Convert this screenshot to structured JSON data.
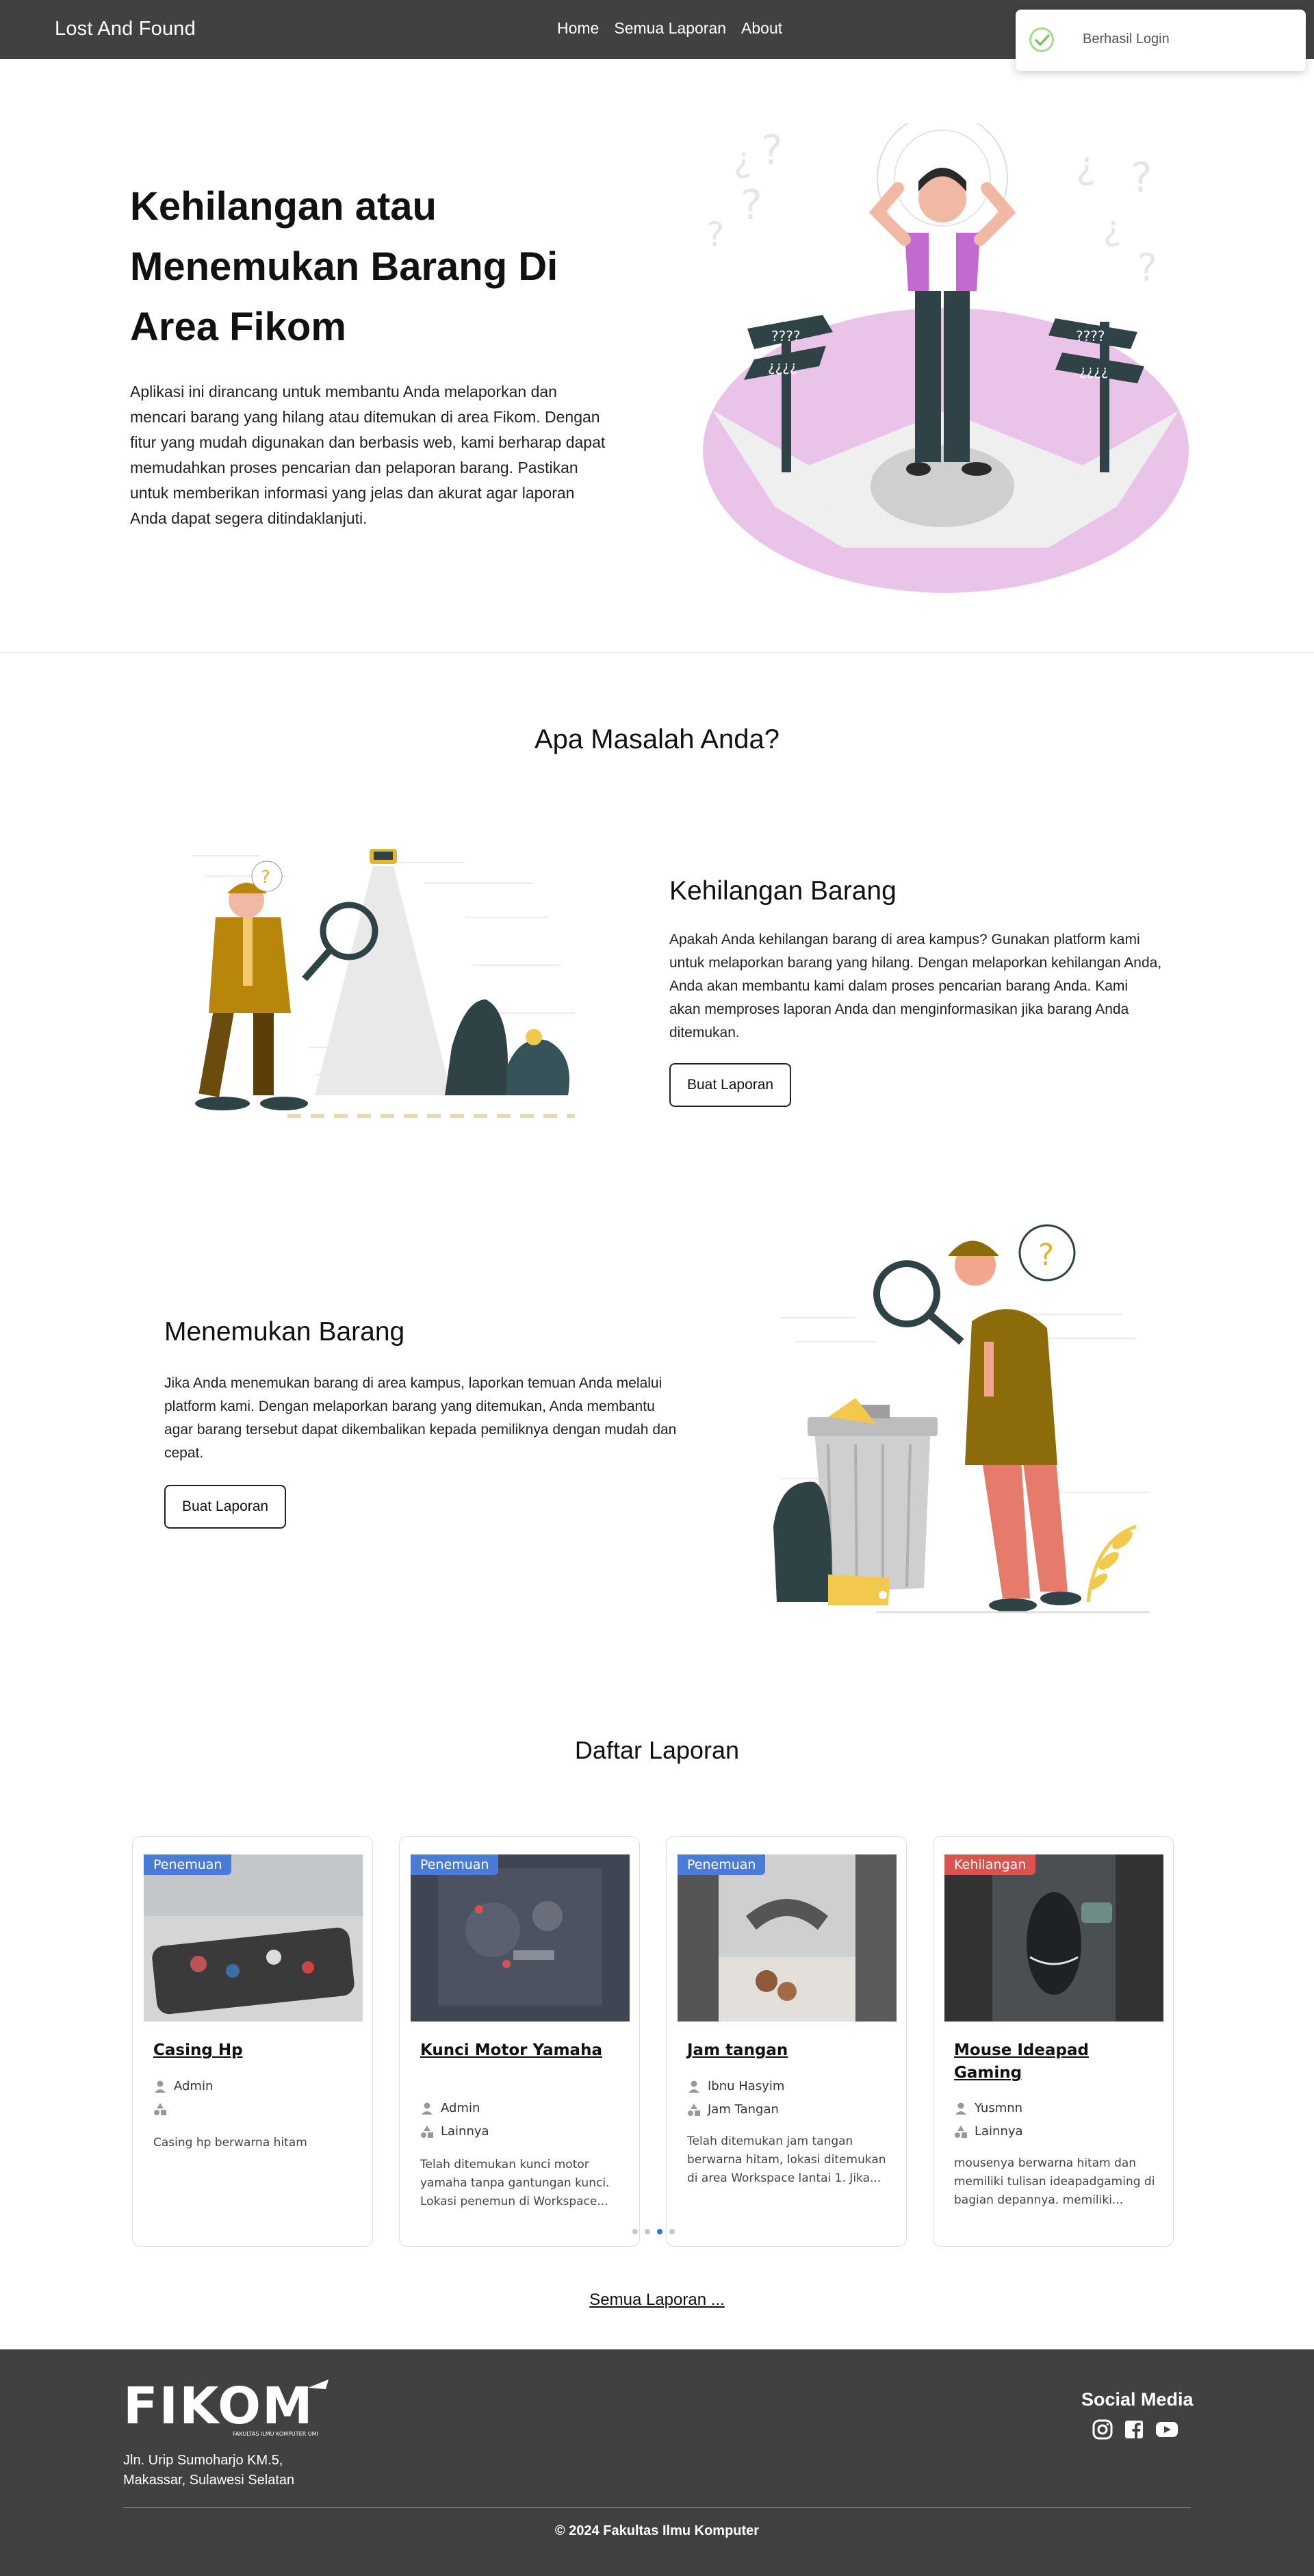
{
  "nav": {
    "brand": "Lost And Found",
    "links": [
      "Home",
      "Semua Laporan",
      "About"
    ]
  },
  "toast": {
    "message": "Berhasil Login",
    "icon": "check-circle-icon"
  },
  "hero": {
    "title": "Kehilangan atau Menemukan Barang Di Area Fikom",
    "description": "Aplikasi ini dirancang untuk membantu Anda melaporkan dan mencari barang yang hilang atau ditemukan di area Fikom. Dengan fitur yang mudah digunakan dan berbasis web, kami berharap dapat memudahkan proses pencarian dan pelaporan barang. Pastikan untuk memberikan informasi yang jelas dan akurat agar laporan Anda dapat segera ditindaklanjuti."
  },
  "problem": {
    "title": "Apa Masalah Anda?",
    "lost": {
      "title": "Kehilangan Barang",
      "description": "Apakah Anda kehilangan barang di area kampus? Gunakan platform kami untuk melaporkan barang yang hilang. Dengan melaporkan kehilangan Anda, Anda akan membantu kami dalam proses pencarian barang Anda. Kami akan memproses laporan Anda dan menginformasikan jika barang Anda ditemukan.",
      "button": "Buat Laporan"
    },
    "found": {
      "title": "Menemukan Barang",
      "description": "Jika Anda menemukan barang di area kampus, laporkan temuan Anda melalui platform kami. Dengan melaporkan barang yang ditemukan, Anda membantu agar barang tersebut dapat dikembalikan kepada pemiliknya dengan mudah dan cepat.",
      "button": "Buat Laporan"
    }
  },
  "reports": {
    "title": "Daftar Laporan",
    "cards": [
      {
        "badge": "Penemuan",
        "title": "Casing Hp",
        "reporter": "Admin",
        "location": "",
        "description": "Casing hp berwarna hitam"
      },
      {
        "badge": "Penemuan",
        "title": "Kunci Motor Yamaha",
        "reporter": "Admin",
        "location": "Lainnya",
        "description": "Telah ditemukan kunci motor yamaha tanpa gantungan kunci. Lokasi penemun di Workspace..."
      },
      {
        "badge": "Penemuan",
        "title": "Jam tangan",
        "reporter": "Ibnu Hasyim",
        "location": "Jam Tangan",
        "description": "Telah ditemukan jam tangan berwarna hitam, lokasi ditemukan di area Workspace lantai 1. Jika..."
      },
      {
        "badge": "Kehilangan",
        "title": "Mouse Ideapad Gaming",
        "reporter": "Yusmnn",
        "location": "Lainnya",
        "description": "mousenya berwarna hitam dan memiliki tulisan ideapadgaming di bagian depannya. memiliki..."
      }
    ],
    "carousel_active_index": 2,
    "all_link": "Semua Laporan ..."
  },
  "footer": {
    "logo_text": "FIKOM",
    "logo_subtext": "FAKULTAS ILMU KOMPUTER UMI",
    "address_line1": "Jln. Urip Sumoharjo KM.5,",
    "address_line2": "Makassar, Sulawesi Selatan",
    "social_title": "Social Media",
    "social_icons": [
      "instagram-icon",
      "facebook-icon",
      "youtube-icon"
    ],
    "copyright": "© 2024 Fakultas Ilmu Komputer"
  },
  "colors": {
    "navbar": "#414141",
    "badge_found": "#4a7bd6",
    "badge_lost": "#d9534f",
    "accent_pink": "#e9c3e8",
    "illustration_yellow": "#b8860b"
  }
}
